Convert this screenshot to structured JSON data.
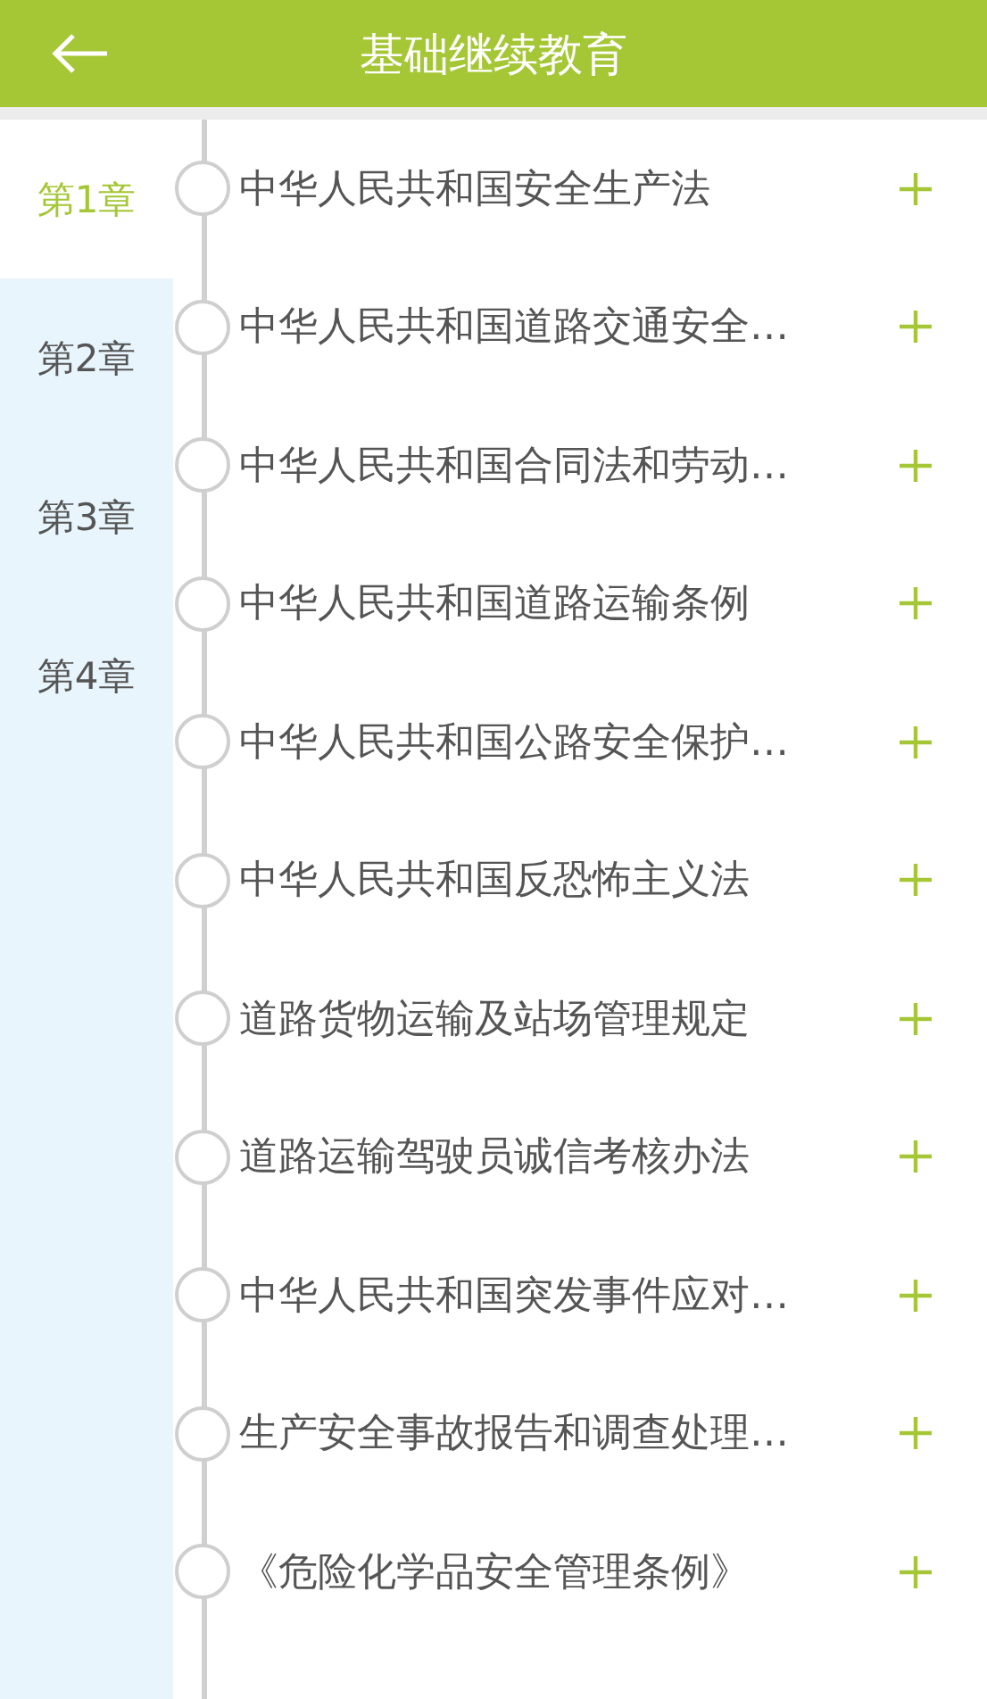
{
  "header": {
    "title": "基础继续教育"
  },
  "chapters": [
    {
      "label": "第1章",
      "selected": true
    },
    {
      "label": "第2章",
      "selected": false
    },
    {
      "label": "第3章",
      "selected": false
    },
    {
      "label": "第4章",
      "selected": false
    }
  ],
  "sections": [
    {
      "title": "中华人民共和国安全生产法"
    },
    {
      "title": "中华人民共和国道路交通安全…"
    },
    {
      "title": "中华人民共和国合同法和劳动…"
    },
    {
      "title": "中华人民共和国道路运输条例"
    },
    {
      "title": "中华人民共和国公路安全保护…"
    },
    {
      "title": "中华人民共和国反恐怖主义法"
    },
    {
      "title": "道路货物运输及站场管理规定"
    },
    {
      "title": "道路运输驾驶员诚信考核办法"
    },
    {
      "title": "中华人民共和国突发事件应对…"
    },
    {
      "title": "生产安全事故报告和调查处理…"
    },
    {
      "title": "《危险化学品安全管理条例》"
    }
  ]
}
